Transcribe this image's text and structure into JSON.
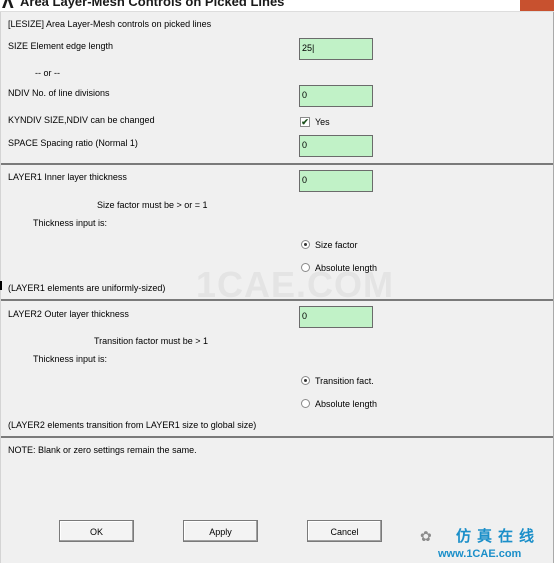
{
  "window": {
    "title_icon": "Λ",
    "title": "Area Layer-Mesh Controls on Picked Lines"
  },
  "header": {
    "command": "[LESIZE]  Area Layer-Mesh controls on picked lines"
  },
  "size": {
    "label": "SIZE  Element edge length",
    "value": "25|"
  },
  "or": {
    "text": "-- or --"
  },
  "ndiv": {
    "label": "NDIV  No. of line divisions",
    "value": "0"
  },
  "kyndiv": {
    "label": "KYNDIV  SIZE,NDIV can be changed",
    "checked": true,
    "check_glyph": "✔",
    "option_label": "Yes"
  },
  "space": {
    "label": "SPACE  Spacing ratio (Normal 1)",
    "value": "0"
  },
  "layer1": {
    "label": "LAYER1  Inner layer thickness",
    "value": "0",
    "hint": "Size factor must be > or = 1",
    "input_is": "Thickness input is:",
    "options": [
      "Size factor",
      "Absolute length"
    ],
    "selected": 0,
    "note": "(LAYER1 elements are uniformly-sized)"
  },
  "watermark": "1CAE.COM",
  "layer2": {
    "label": "LAYER2  Outer layer thickness",
    "value": "0",
    "hint": "Transition factor must be > 1",
    "input_is": "Thickness input is:",
    "options": [
      "Transition fact.",
      "Absolute length"
    ],
    "selected": 0,
    "note": "(LAYER2 elements transition from LAYER1 size to global size)"
  },
  "note": "NOTE:  Blank or zero settings remain the same.",
  "buttons": {
    "ok": "OK",
    "apply": "Apply",
    "cancel": "Cancel"
  },
  "brand": {
    "wechat_icon": "✿",
    "cn": "仿真在线",
    "url": "www.1CAE.com"
  },
  "colors": {
    "field_bg": "#c1f2c7",
    "dialog_bg": "#f0f0f0",
    "brand": "#1b8fc9"
  }
}
